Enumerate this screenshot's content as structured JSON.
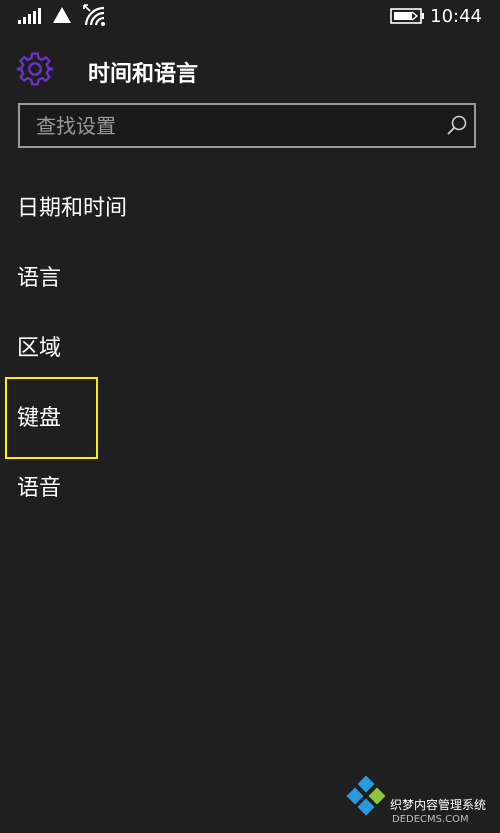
{
  "status_bar": {
    "time": "10:44",
    "icons": [
      "signal-icon",
      "data-triangle-icon",
      "wifi-icon",
      "battery-charging-icon"
    ]
  },
  "header": {
    "title": "时间和语言",
    "icon": "gear-icon"
  },
  "search": {
    "placeholder": "查找设置",
    "icon": "search-icon"
  },
  "menu": {
    "items": [
      {
        "label": "日期和时间"
      },
      {
        "label": "语言"
      },
      {
        "label": "区域"
      },
      {
        "label": "键盘"
      },
      {
        "label": "语音"
      }
    ]
  },
  "colors": {
    "background": "#1f1f1f",
    "accent": "#6b33c9",
    "highlight": "#ffee00"
  },
  "watermark": {
    "text": "织梦内容管理系统",
    "sub": "DEDECMS.COM"
  }
}
